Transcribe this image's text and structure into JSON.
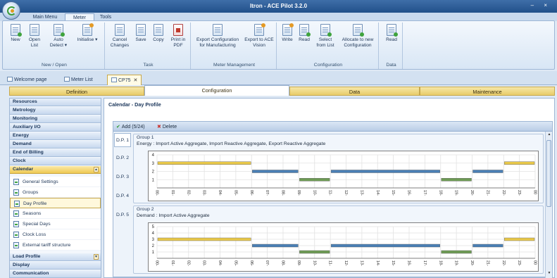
{
  "window": {
    "title": "Itron - ACE Pilot 3.2.0",
    "controls": "– ×"
  },
  "ribbon_tabs": [
    {
      "label": "Main Menu"
    },
    {
      "label": "Meter"
    },
    {
      "label": "Tools"
    }
  ],
  "ribbon_groups": [
    {
      "label": "New / Open",
      "buttons": [
        "New",
        "Open List",
        "Auto Detect ▾",
        "Initialise ▾"
      ]
    },
    {
      "label": "Task",
      "buttons": [
        "Cancel Changes",
        "Save",
        "Copy",
        "Print in PDF"
      ]
    },
    {
      "label": "Meter Management",
      "buttons": [
        "Export Configuration for Manufacturing",
        "Export to ACE Vision"
      ]
    },
    {
      "label": "Configuration",
      "buttons": [
        "Write",
        "Read",
        "Select from List",
        "Allocate to new Configuration"
      ]
    },
    {
      "label": "Data",
      "buttons": [
        "Read"
      ]
    }
  ],
  "doc_tabs": [
    {
      "label": "Welcome page"
    },
    {
      "label": "Meter List"
    },
    {
      "label": "CP75",
      "close": "✕"
    }
  ],
  "section_tabs": [
    {
      "label": "Definition"
    },
    {
      "label": "Configuration"
    },
    {
      "label": "Data"
    },
    {
      "label": "Maintenance"
    }
  ],
  "left_panel": {
    "categories": [
      "Resources",
      "Metrology",
      "Monitoring",
      "Auxiliary I/O",
      "Energy",
      "Demand",
      "End of Billing",
      "Clock",
      "Calendar"
    ],
    "calendar_items": [
      "General Settings",
      "Groups",
      "Day Profile",
      "Seasons",
      "Special Days",
      "Clock Loss",
      "External tariff structure"
    ],
    "bottom_categories": [
      "Load Profile",
      "Display",
      "Communication"
    ],
    "expander_up": "▲",
    "expander_down": "▼"
  },
  "main": {
    "title": "Calendar - Day Profile",
    "toolbar": {
      "add_label": "Add (5/24)",
      "add_mark": "✔",
      "delete_label": "Delete",
      "delete_mark": "✖"
    },
    "day_profiles": [
      "D.P. 1",
      "D.P. 2",
      "D.P. 3",
      "D.P. 4",
      "D.P. 5"
    ],
    "scroll_up": "▲",
    "scroll_down": "▼"
  },
  "colors": {
    "rate1": "#6e9b55",
    "rate2": "#4a7fb5",
    "rate3": "#e8c84a",
    "ribbon_bg": "#dbe7f5",
    "accent": "#eec953"
  },
  "chart_data": [
    {
      "type": "bar",
      "title": "Group 1",
      "subtitle": "Energy : Import Active Aggregate, Import Reactive Aggregate, Export Reactive Aggregate",
      "x": [
        "00-",
        "01-",
        "02-",
        "03-",
        "04-",
        "05-",
        "06-",
        "07-",
        "08-",
        "09-",
        "10-",
        "11-",
        "12-",
        "13-",
        "14-",
        "15-",
        "16-",
        "17-",
        "18-",
        "19-",
        "20-",
        "21-",
        "22-",
        "23-",
        "00"
      ],
      "y_ticks": [
        1,
        2,
        3,
        4
      ],
      "ylim": [
        0,
        4
      ],
      "segments": [
        {
          "start": 0,
          "end": 6,
          "rate": 3
        },
        {
          "start": 6,
          "end": 9,
          "rate": 2
        },
        {
          "start": 9,
          "end": 11,
          "rate": 1
        },
        {
          "start": 11,
          "end": 18,
          "rate": 2
        },
        {
          "start": 18,
          "end": 20,
          "rate": 1
        },
        {
          "start": 20,
          "end": 22,
          "rate": 2
        },
        {
          "start": 22,
          "end": 24,
          "rate": 3
        }
      ]
    },
    {
      "type": "bar",
      "title": "Group 2",
      "subtitle": "Demand : Import Active Aggregate",
      "x": [
        "00-",
        "01-",
        "02-",
        "03-",
        "04-",
        "05-",
        "06-",
        "07-",
        "08-",
        "09-",
        "10-",
        "11-",
        "12-",
        "13-",
        "14-",
        "15-",
        "16-",
        "17-",
        "18-",
        "19-",
        "20-",
        "21-",
        "22-",
        "23-",
        "00"
      ],
      "y_ticks": [
        1,
        2,
        3,
        4,
        5
      ],
      "ylim": [
        0,
        5
      ],
      "segments": [
        {
          "start": 0,
          "end": 6,
          "rate": 3
        },
        {
          "start": 6,
          "end": 9,
          "rate": 2
        },
        {
          "start": 9,
          "end": 11,
          "rate": 1
        },
        {
          "start": 11,
          "end": 18,
          "rate": 2
        },
        {
          "start": 18,
          "end": 20,
          "rate": 1
        },
        {
          "start": 20,
          "end": 22,
          "rate": 2
        },
        {
          "start": 22,
          "end": 24,
          "rate": 3
        }
      ]
    }
  ]
}
